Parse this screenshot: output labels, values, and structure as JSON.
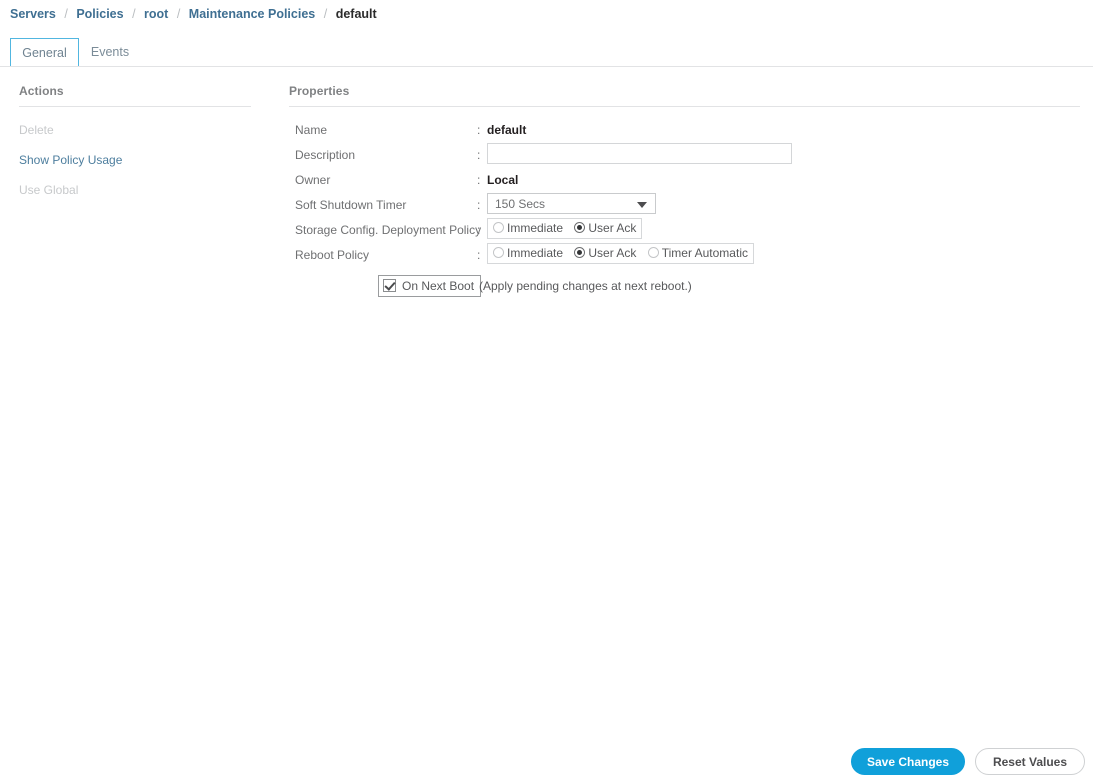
{
  "breadcrumb": {
    "separator": "/",
    "items": [
      {
        "label": "Servers",
        "current": false
      },
      {
        "label": "Policies",
        "current": false
      },
      {
        "label": "root",
        "current": false
      },
      {
        "label": "Maintenance Policies",
        "current": false
      },
      {
        "label": "default",
        "current": true
      }
    ]
  },
  "tabs": {
    "general": "General",
    "events": "Events",
    "active": "General"
  },
  "actions": {
    "title": "Actions",
    "delete": "Delete",
    "show_policy_usage": "Show Policy Usage",
    "use_global": "Use Global"
  },
  "properties": {
    "title": "Properties",
    "colon": ":",
    "name": {
      "label": "Name",
      "value": "default"
    },
    "description": {
      "label": "Description",
      "value": "",
      "placeholder": ""
    },
    "owner": {
      "label": "Owner",
      "value": "Local"
    },
    "soft_shutdown_timer": {
      "label": "Soft Shutdown Timer",
      "value": "150 Secs",
      "options": [
        "150 Secs"
      ]
    },
    "storage_config_deployment_policy": {
      "label": "Storage Config. Deployment Policy",
      "selected": "User Ack",
      "options": [
        "Immediate",
        "User Ack"
      ]
    },
    "reboot_policy": {
      "label": "Reboot Policy",
      "selected": "User Ack",
      "options": [
        "Immediate",
        "User Ack",
        "Timer Automatic"
      ]
    },
    "on_next_boot": {
      "label": "On Next Boot",
      "checked": true,
      "hint": "(Apply pending changes at next reboot.)"
    }
  },
  "footer": {
    "save": "Save Changes",
    "reset": "Reset Values"
  },
  "colors": {
    "accent": "#10a0da",
    "breadcrumb_link": "#3f6f92",
    "tab_active_border": "#51b6e0",
    "label_grey": "#6f7072",
    "disabled_grey": "#c7c9cb"
  }
}
